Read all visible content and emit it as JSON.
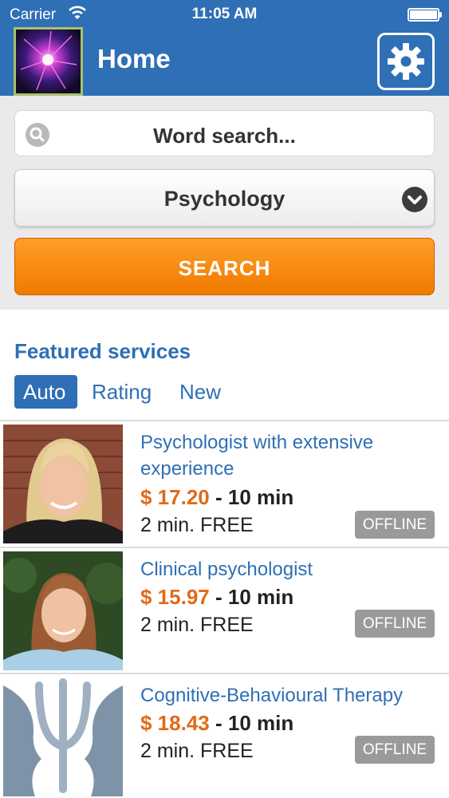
{
  "status_bar": {
    "carrier": "Carrier",
    "time": "11:05 AM"
  },
  "nav": {
    "title": "Home",
    "settings_icon": "gear-icon"
  },
  "search": {
    "word_placeholder": "Word search...",
    "category": "Psychology",
    "button_label": "SEARCH"
  },
  "featured": {
    "title": "Featured services",
    "tabs": [
      {
        "label": "Auto",
        "active": true
      },
      {
        "label": "Rating",
        "active": false
      },
      {
        "label": "New",
        "active": false
      }
    ],
    "items": [
      {
        "title": "Psychologist with extensive experience",
        "price": "$ 17.20",
        "duration": " - 10 min",
        "free": "2 min. FREE",
        "status": "OFFLINE"
      },
      {
        "title": "Clinical psychologist",
        "price": "$ 15.97",
        "duration": " - 10 min",
        "free": "2 min. FREE",
        "status": "OFFLINE"
      },
      {
        "title": "Cognitive-Behavioural Therapy",
        "price": "$ 18.43",
        "duration": " - 10 min",
        "free": "2 min. FREE",
        "status": "OFFLINE"
      }
    ]
  },
  "colors": {
    "primary": "#2f6fb5",
    "accent": "#f07a00",
    "price": "#e26a17",
    "badge": "#9a9a9a"
  }
}
